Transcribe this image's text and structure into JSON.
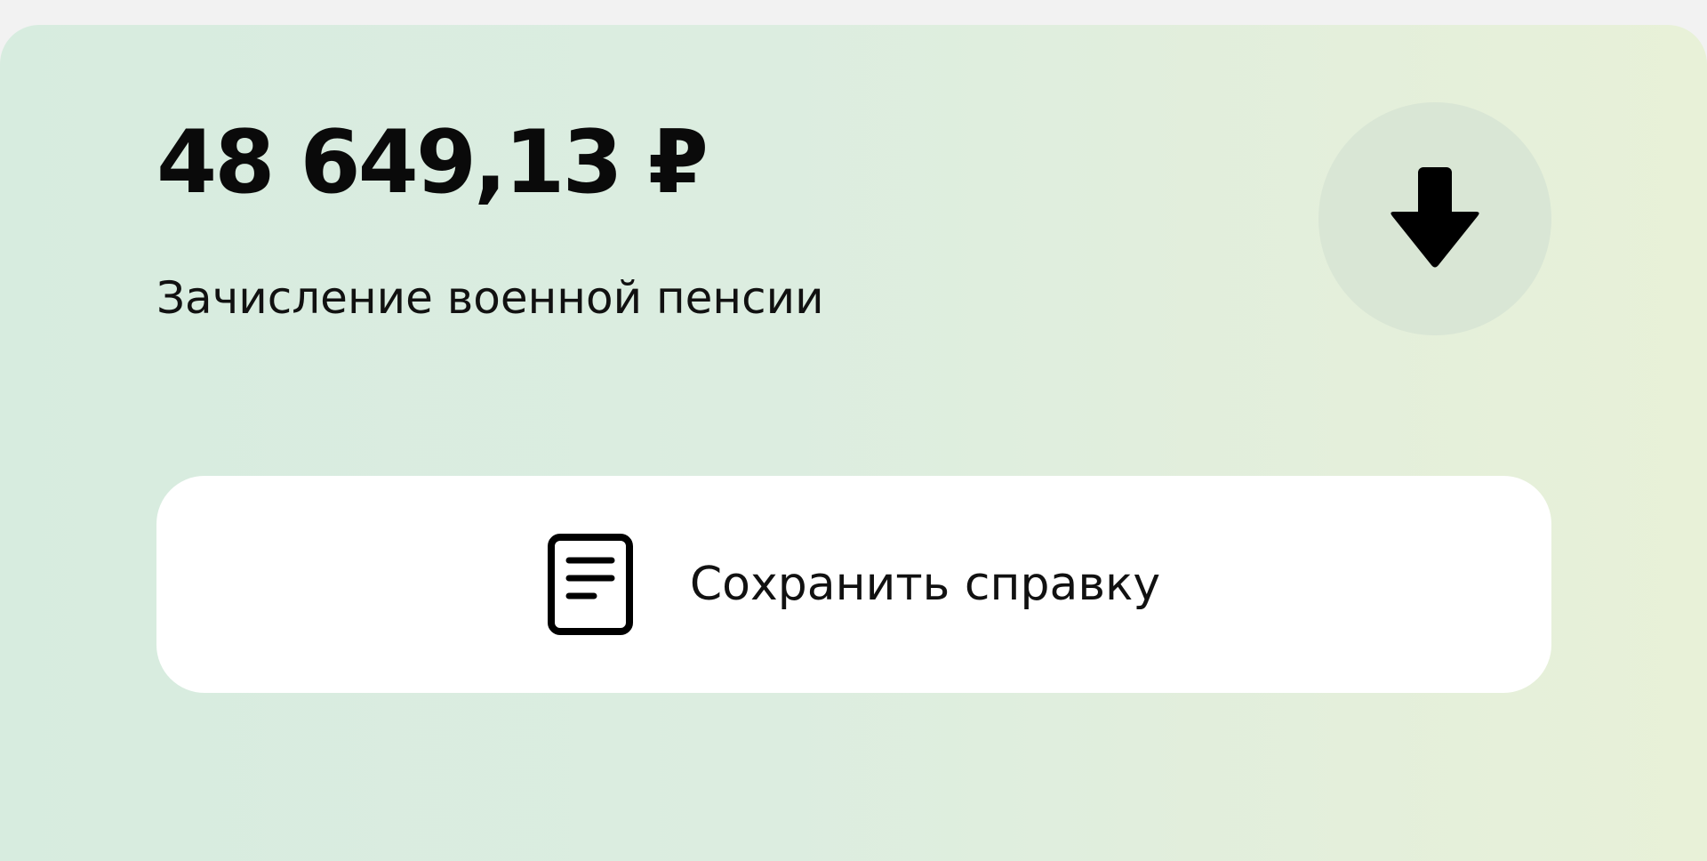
{
  "operation": {
    "amount": "48 649,13 ₽",
    "description": "Зачисление военной пенсии",
    "direction_icon": "arrow-down-icon"
  },
  "actions": {
    "save_certificate_label": "Сохранить справку",
    "save_certificate_icon": "document-icon"
  },
  "colors": {
    "card_gradient_start": "#d7ecdf",
    "card_gradient_end": "#e8f1d8",
    "icon_circle": "#d9e6d5",
    "button_background": "#ffffff",
    "text": "#0a0a0a"
  }
}
